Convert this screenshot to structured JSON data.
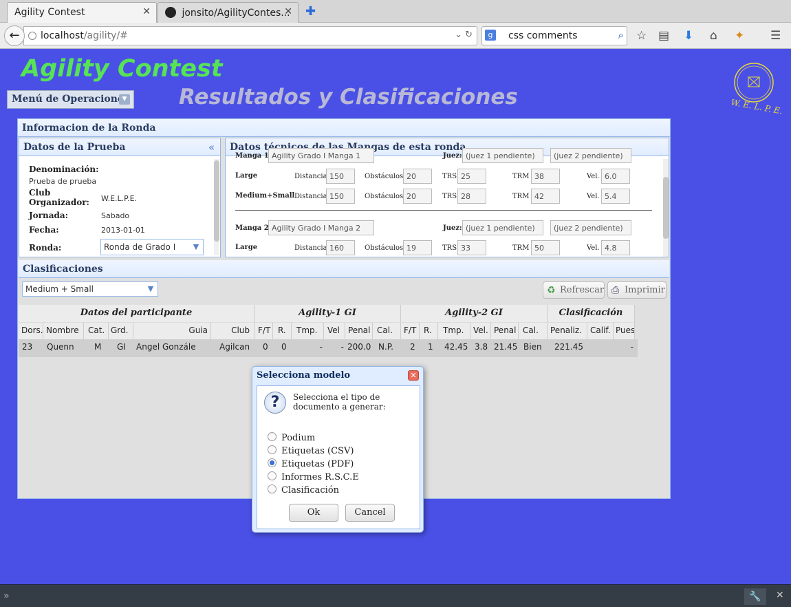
{
  "browser": {
    "tabs": [
      {
        "label": "Agility Contest"
      },
      {
        "label": "jonsito/AgilityContes..."
      }
    ],
    "url_host": "localhost",
    "url_path": "/agility/#",
    "search_text": "css comments"
  },
  "page": {
    "app_title": "Agility Contest",
    "subtitle": "Resultados y Clasificaciones",
    "menu_label": "Menú de Operaciones"
  },
  "ronda_panel": {
    "title": "Informacion de la Ronda",
    "prueba": {
      "title": "Datos de la Prueba",
      "fields": [
        {
          "label": "Denominación:",
          "value": "Prueba de prueba"
        },
        {
          "label": "Club Organizador:",
          "value": "W.E.L.P.E."
        },
        {
          "label": "Jornada:",
          "value": "Sabado"
        },
        {
          "label": "Fecha:",
          "value": "2013-01-01"
        },
        {
          "label": "Ronda:",
          "value": "Ronda de Grado I"
        }
      ]
    },
    "tecnicos": {
      "title": "Datos técnicos de las Mangas de esta ronda",
      "manga1": {
        "label": "Manga 1:",
        "name": "Agility Grado I Manga 1",
        "juez_label": "Juez:",
        "juez1": "(juez 1 pendiente)",
        "juez2": "(juez 2 pendiente)",
        "rows": [
          {
            "cat": "Large",
            "distancia": "150",
            "obstaculos": "20",
            "trs": "25",
            "trm": "38",
            "vel": "6.0"
          },
          {
            "cat": "Medium+Small",
            "distancia": "150",
            "obstaculos": "20",
            "trs": "28",
            "trm": "42",
            "vel": "5.4"
          }
        ]
      },
      "manga2": {
        "label": "Manga 2:",
        "name": "Agility Grado I Manga 2",
        "juez_label": "Juez:",
        "juez1": "(juez 1 pendiente)",
        "juez2": "(juez 2 pendiente)",
        "rows": [
          {
            "cat": "Large",
            "distancia": "160",
            "obstaculos": "19",
            "trs": "33",
            "trm": "50",
            "vel": "4.8"
          }
        ]
      },
      "labels": {
        "distancia": "Distancia",
        "obstaculos": "Obstáculos",
        "trs": "TRS",
        "trm": "TRM",
        "vel": "Vel."
      }
    }
  },
  "clasificaciones": {
    "title": "Clasificaciones",
    "category": "Medium + Small",
    "refresh_label": "Refrescar",
    "print_label": "Imprimir",
    "groups": [
      "Datos del participante",
      "Agility-1 GI",
      "Agility-2 GI",
      "Clasificación"
    ],
    "columns": [
      "Dors.",
      "Nombre",
      "Cat.",
      "Grd.",
      "Guia",
      "Club",
      "F/T",
      "R.",
      "Tmp.",
      "Vel",
      "Penal",
      "Cal.",
      "F/T",
      "R.",
      "Tmp.",
      "Vel.",
      "Penal",
      "Cal.",
      "Penaliz.",
      "Calif.",
      "Pues"
    ],
    "rows": [
      [
        "23",
        "Quenn",
        "M",
        "GI",
        "Angel Gonzále",
        "Agilcan",
        "0",
        "0",
        "-",
        "-",
        "200.0",
        "N.P.",
        "2",
        "1",
        "42.45",
        "3.8",
        "21.45",
        "Bien",
        "221.45",
        "",
        "-"
      ]
    ]
  },
  "dialog": {
    "title": "Selecciona modelo",
    "message": "Selecciona el tipo de documento a generar:",
    "options": [
      "Podium",
      "Etiquetas (CSV)",
      "Etiquetas (PDF)",
      "Informes R.S.C.E",
      "Clasificación"
    ],
    "selected_index": 2,
    "ok_label": "Ok",
    "cancel_label": "Cancel"
  }
}
